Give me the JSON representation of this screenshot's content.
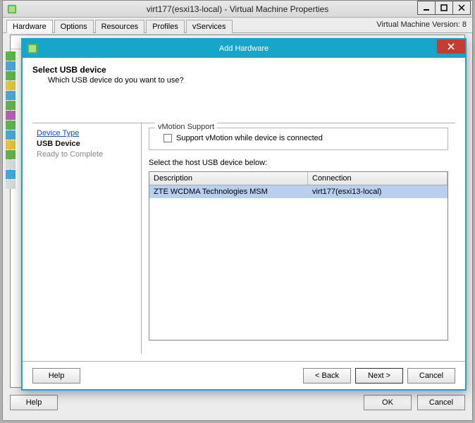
{
  "parent_window": {
    "title": "virt177(esxi13-local) - Virtual Machine Properties",
    "tabs": [
      "Hardware",
      "Options",
      "Resources",
      "Profiles",
      "vServices"
    ],
    "version_label": "Virtual Machine Version: 8",
    "buttons": {
      "help": "Help",
      "ok": "OK",
      "cancel": "Cancel"
    }
  },
  "dialog": {
    "title": "Add Hardware",
    "heading": "Select USB device",
    "subheading": "Which USB device do you want to use?",
    "nav": {
      "device_type": "Device Type",
      "usb_device": "USB Device",
      "ready": "Ready to Complete"
    },
    "vmotion": {
      "legend": "vMotion Support",
      "checkbox_label": "Support vMotion while device is connected"
    },
    "table": {
      "caption": "Select the host USB device below:",
      "cols": {
        "description": "Description",
        "connection": "Connection"
      },
      "rows": [
        {
          "description": "ZTE WCDMA Technologies MSM",
          "connection": "virt177(esxi13-local)"
        }
      ]
    },
    "buttons": {
      "help": "Help",
      "back": "< Back",
      "next": "Next >",
      "cancel": "Cancel"
    }
  }
}
